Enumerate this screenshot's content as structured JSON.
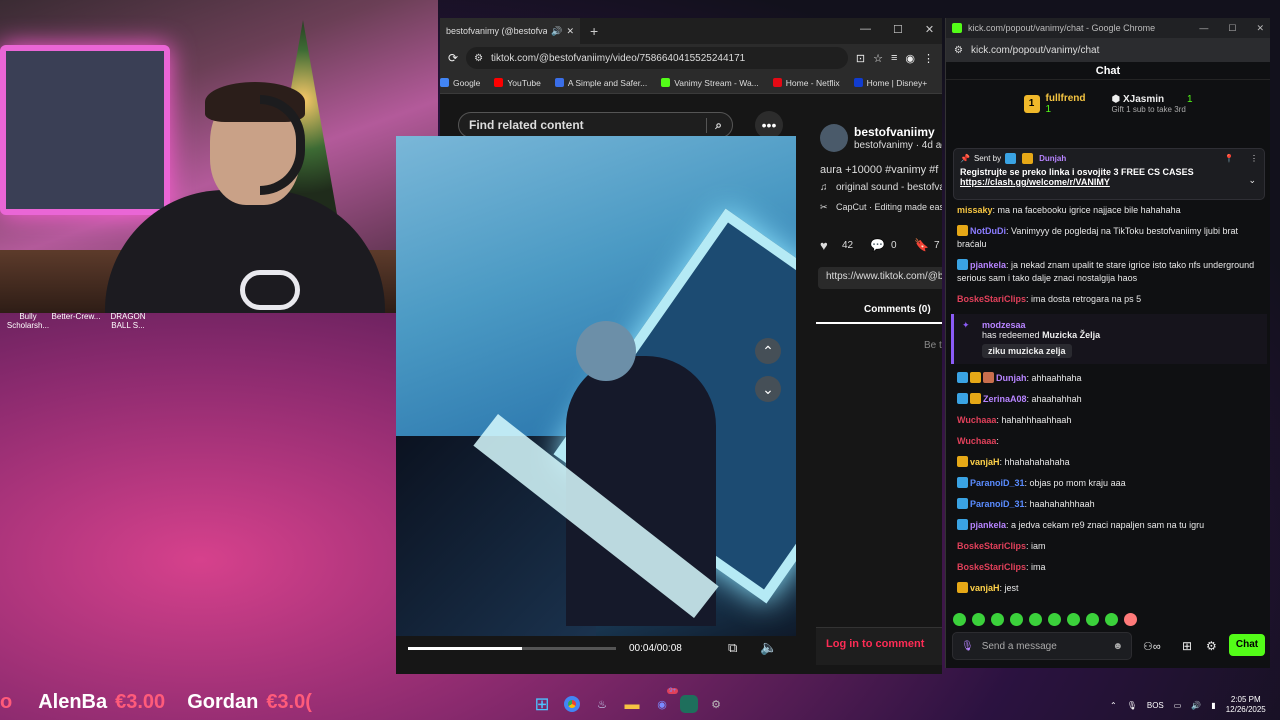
{
  "desktop_icons": [
    "Bully Scholarsh...",
    "Better-Crew...",
    "DRAGON BALL S..."
  ],
  "tiktok_window": {
    "tab_title": "bestofvanimy (@bestofvanimy)",
    "url": "tiktok.com/@bestofvaniimy/video/7586640415525244171",
    "bookmarks": [
      {
        "label": "Google",
        "color": "#4285f4"
      },
      {
        "label": "YouTube",
        "color": "#ff0000"
      },
      {
        "label": "A Simple and Safer...",
        "color": "#3a6ee8"
      },
      {
        "label": "Vanimy Stream - Wa...",
        "color": "#53fc18"
      },
      {
        "label": "Home - Netflix",
        "color": "#e50914"
      },
      {
        "label": "Home | Disney+",
        "color": "#113ccf"
      }
    ],
    "search_placeholder": "Find related content",
    "video_time": "00:04/00:08",
    "progress": 0.55,
    "author_handle": "bestofvaniimy",
    "author_sub": "bestofvanimy · 4d ag",
    "caption": "aura +10000 #vanimy #f",
    "sound": "original sound - bestofva",
    "capcut": "CapCut · Editing made eas",
    "likes": "42",
    "comments_count": "0",
    "saves": "7",
    "link": "https://www.tiktok.com/@b",
    "comments_tab": "Comments (0)",
    "be_first": "Be t",
    "login_comment": "Log in to comment"
  },
  "kick_window": {
    "window_title": "kick.com/popout/vanimy/chat - Google Chrome",
    "url": "kick.com/popout/vanimy/chat",
    "header": "Chat",
    "leader1": {
      "rank": "1",
      "name": "fullfrend",
      "count": "1"
    },
    "leader2": {
      "name": "XJasmin",
      "count": "1",
      "gift": "Gift 1 sub to take 3rd"
    },
    "pinned": {
      "sent_by": "Sent by",
      "user": "Dunjah",
      "text": "Registrujte se preko linka i osvojite 3 FREE CS CASES",
      "link": "https://clash.gg/welcome/r/VANIMY"
    },
    "messages_top": [
      {
        "user": "missaky",
        "color": "#f5c542",
        "text": ": ma na facebooku igrice najjace bile hahahaha",
        "badges": []
      },
      {
        "user": "NotDuDi",
        "color": "#8b7cff",
        "text": ": Vanimyyy de pogledaj na TikToku bestofvaniimy ljubi brat braćalu",
        "badges": [
          "#e6a817"
        ]
      },
      {
        "user": "pjankela",
        "color": "#b784ff",
        "text": ": ja nekad znam upalit te stare igrice isto tako nfs underground serious sam i tako dalje znaci nostalgija haos",
        "badges": [
          "#3aa3e3"
        ]
      },
      {
        "user": "BoskeStariClips",
        "color": "#e0405a",
        "text": ": ima dosta retrogara na ps 5",
        "badges": []
      }
    ],
    "redeem": {
      "user": "modzesaa",
      "text": "has redeemed",
      "reward": "Muzicka Želja",
      "note": "ziku muzicka zelja"
    },
    "messages_bottom": [
      {
        "user": "Dunjah",
        "color": "#b784ff",
        "text": ": ahhaahhaha",
        "badges": [
          "#3aa3e3",
          "#e6a817",
          "#c96e4d"
        ]
      },
      {
        "user": "ZerinaA08",
        "color": "#b784ff",
        "text": ": ahaahahhah",
        "badges": [
          "#3aa3e3",
          "#e6a817"
        ]
      },
      {
        "user": "Wuchaaa",
        "color": "#e0405a",
        "text": ": hahahhhaahhaah",
        "badges": []
      },
      {
        "user": "Wuchaaa",
        "color": "#e0405a",
        "text": ":",
        "badges": []
      },
      {
        "user": "vanjaH",
        "color": "#ffd24a",
        "text": ": hhahahahahaha",
        "badges": [
          "#e6a817"
        ]
      },
      {
        "user": "ParanoiD_31",
        "color": "#5a8cff",
        "text": ": objas po mom kraju aaa",
        "badges": [
          "#3aa3e3"
        ]
      },
      {
        "user": "ParanoiD_31",
        "color": "#5a8cff",
        "text": ": haahahahhhaah",
        "badges": [
          "#3aa3e3"
        ]
      },
      {
        "user": "pjankela",
        "color": "#b784ff",
        "text": ": a jedva cekam re9 znaci napaljen sam na tu igru",
        "badges": [
          "#3aa3e3"
        ]
      },
      {
        "user": "BoskeStariClips",
        "color": "#e0405a",
        "text": ": iam",
        "badges": []
      },
      {
        "user": "BoskeStariClips",
        "color": "#e0405a",
        "text": ": ima",
        "badges": []
      },
      {
        "user": "vanjaH",
        "color": "#ffd24a",
        "text": ": jest",
        "badges": [
          "#e6a817"
        ]
      }
    ],
    "input_placeholder": "Send a message",
    "chat_button": "Chat"
  },
  "ticker": [
    {
      "name": "AlenBa",
      "amount": "€3.00"
    },
    {
      "name": "Gordan",
      "amount": "€3.0("
    }
  ],
  "tray": {
    "lang": "BOS",
    "time": "2:05 PM",
    "date": "12/26/2025",
    "discord_badge": "9+"
  }
}
